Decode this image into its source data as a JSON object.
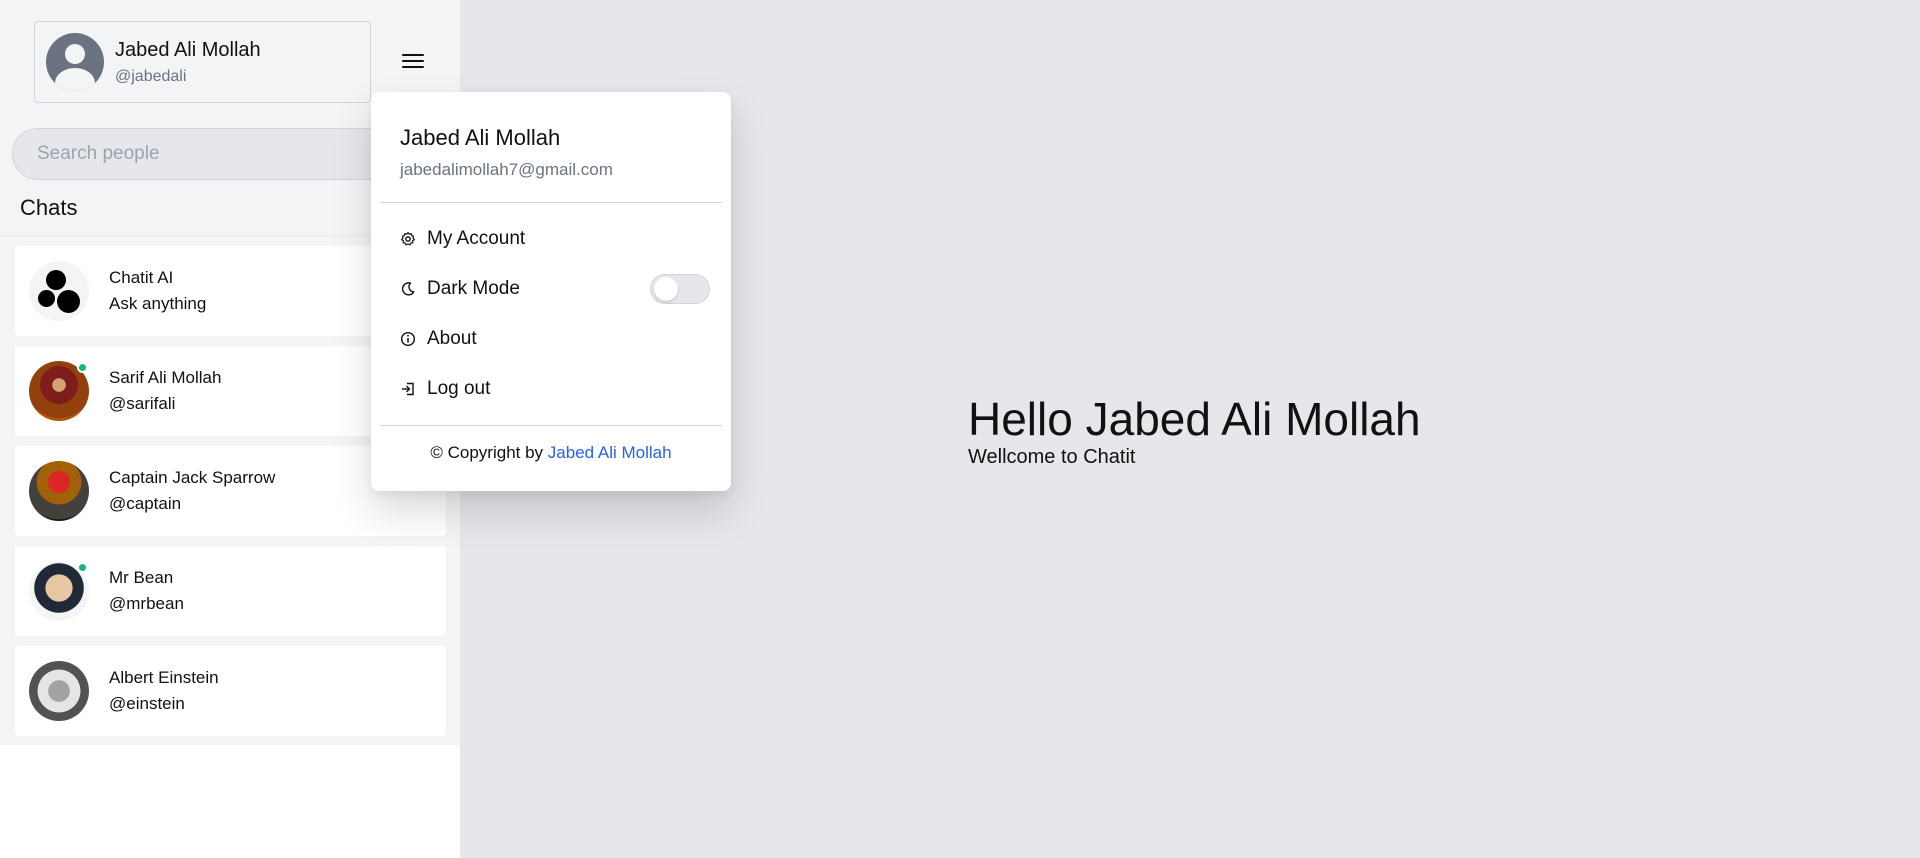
{
  "user": {
    "name": "Jabed Ali Mollah",
    "handle": "@jabedali",
    "email": "jabedalimollah7@gmail.com"
  },
  "search": {
    "placeholder": "Search people"
  },
  "chats": {
    "title": "Chats",
    "items": [
      {
        "name": "Chatit AI",
        "sub": "Ask anything",
        "online": false
      },
      {
        "name": "Sarif Ali Mollah",
        "sub": "@sarifali",
        "online": true
      },
      {
        "name": "Captain Jack Sparrow",
        "sub": "@captain",
        "online": false
      },
      {
        "name": "Mr Bean",
        "sub": "@mrbean",
        "online": true
      },
      {
        "name": "Albert Einstein",
        "sub": "@einstein",
        "online": false
      }
    ]
  },
  "main": {
    "title": "Hello Jabed Ali Mollah",
    "subtitle": "Wellcome to Chatit"
  },
  "menu": {
    "name": "Jabed Ali Mollah",
    "email": "jabedalimollah7@gmail.com",
    "items": [
      {
        "label": "My Account",
        "icon": "gear-icon"
      },
      {
        "label": "Dark Mode",
        "icon": "moon-icon",
        "toggle": false
      },
      {
        "label": "About",
        "icon": "info-icon"
      },
      {
        "label": "Log out",
        "icon": "logout-icon"
      }
    ],
    "footer_prefix": "© Copyright by",
    "footer_link": "Jabed Ali Mollah"
  },
  "colors": {
    "accent_link": "#2563eb",
    "online": "#10b981",
    "main_bg": "#e5e7eb"
  }
}
